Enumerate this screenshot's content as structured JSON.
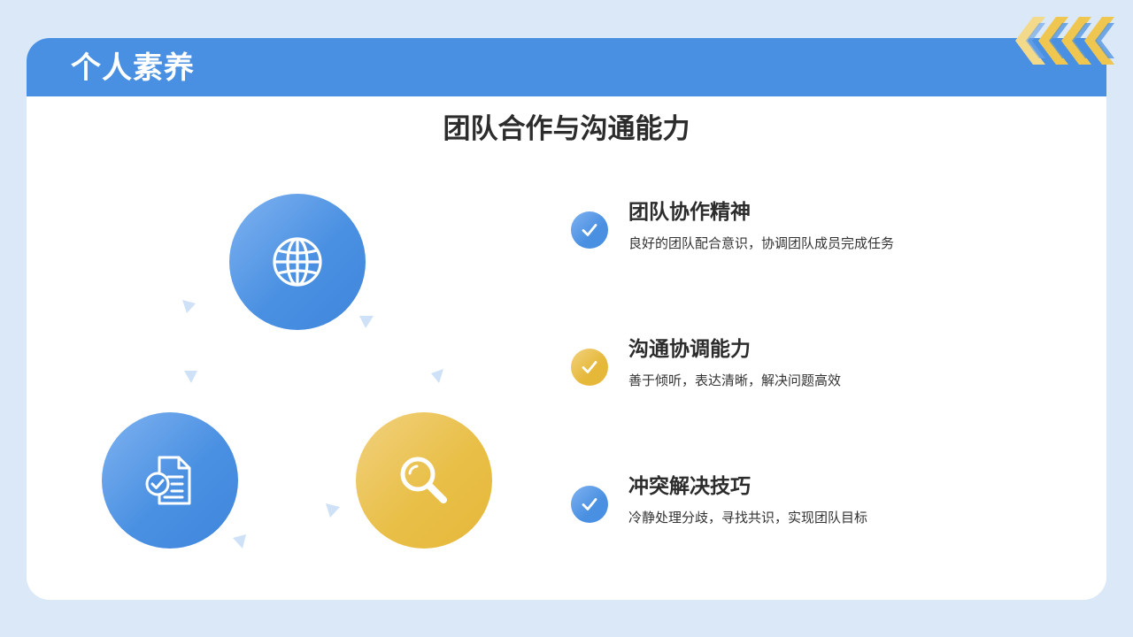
{
  "header": {
    "title": "个人素养"
  },
  "section": {
    "title": "团队合作与沟通能力"
  },
  "icons": {
    "globe": "globe-icon",
    "document": "document-check-icon",
    "search": "search-icon",
    "check": "check-icon"
  },
  "features": [
    {
      "title": "团队协作精神",
      "description": "良好的团队配合意识，协调团队成员完成任务",
      "accent": "blue"
    },
    {
      "title": "沟通协调能力",
      "description": "善于倾听，表达清晰，解决问题高效",
      "accent": "yellow"
    },
    {
      "title": "冲突解决技巧",
      "description": "冷静处理分歧，寻找共识，实现团队目标",
      "accent": "blue"
    }
  ],
  "colors": {
    "primary_blue": "#4a90e2",
    "accent_yellow": "#e9bf48",
    "page_background": "#dbe8f8",
    "text_dark": "#2c2c2c"
  }
}
